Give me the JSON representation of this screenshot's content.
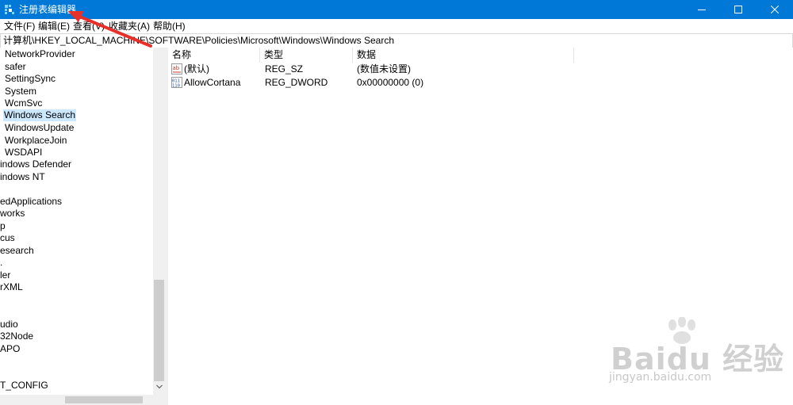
{
  "window": {
    "title": "注册表编辑器",
    "accent_color": "#0078d7",
    "controls": [
      "minimize-icon",
      "maximize-icon",
      "close-icon"
    ]
  },
  "menu": [
    "文件(F)",
    "编辑(E)",
    "查看(V)",
    "收藏夹(A)",
    "帮助(H)"
  ],
  "address": "计算机\\HKEY_LOCAL_MACHINE\\SOFTWARE\\Policies\\Microsoft\\Windows\\Windows Search",
  "tree": [
    "NetworkProvider",
    "safer",
    "SettingSync",
    "System",
    "WcmSvc",
    "Windows Search",
    "WindowsUpdate",
    "WorkplaceJoin",
    "WSDAPI",
    "indows Defender",
    "indows NT",
    "",
    "edApplications",
    "works",
    "p",
    "cus",
    "esearch",
    ".",
    "ler",
    "rXML",
    "",
    "udio",
    "32Node",
    "APO",
    "",
    "T_CONFIG"
  ],
  "tree_selected": "Windows Search",
  "list": {
    "columns": [
      "名称",
      "类型",
      "数据"
    ],
    "rows": [
      {
        "icon": "string-value-icon",
        "name": "(默认)",
        "type": "REG_SZ",
        "data": "(数值未设置)"
      },
      {
        "icon": "dword-value-icon",
        "name": "AllowCortana",
        "type": "REG_DWORD",
        "data": "0x00000000 (0)"
      }
    ]
  },
  "watermark": {
    "logo": "Baidu 经验",
    "url": "jingyan.baidu.com"
  }
}
